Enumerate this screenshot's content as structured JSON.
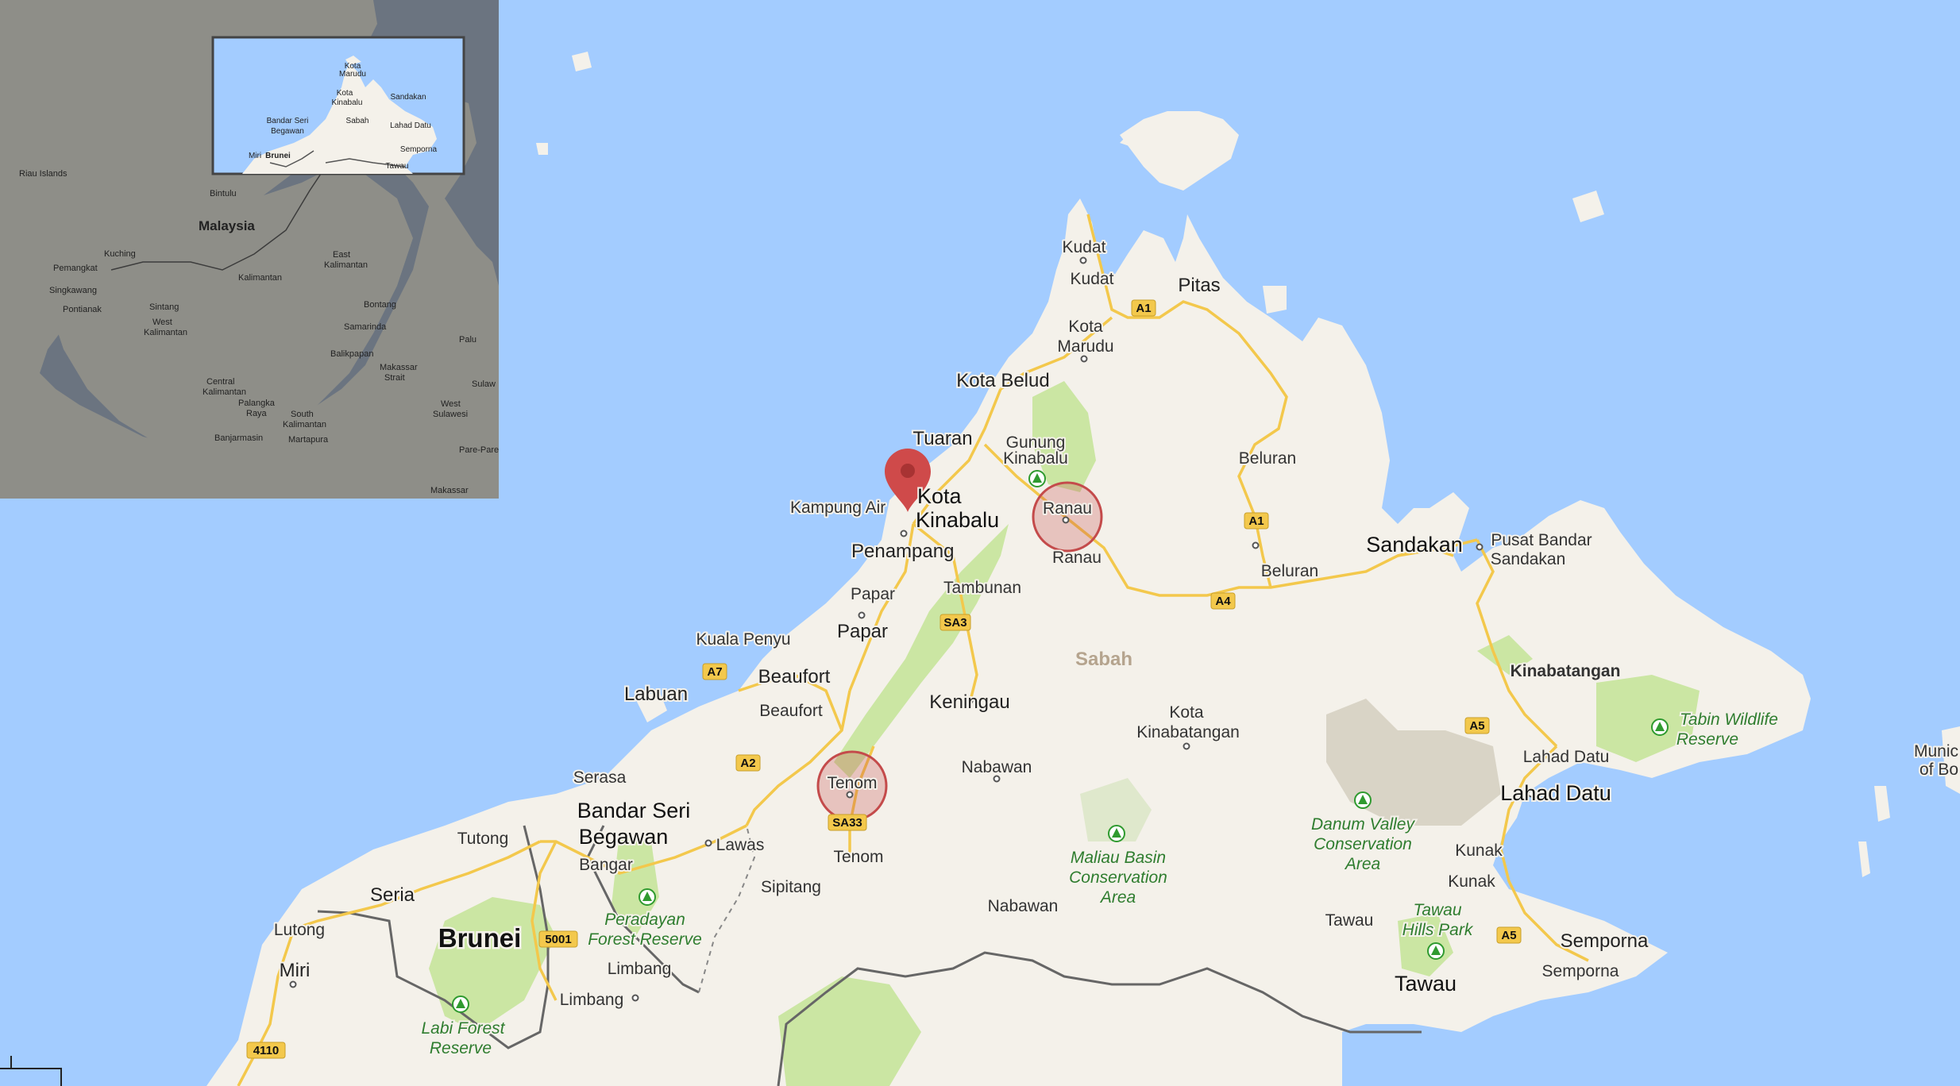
{
  "map": {
    "colors": {
      "water": "#a3ccff",
      "land": "#f4f1ea",
      "park": "#cbe6a3",
      "road": "#f3c84c",
      "border": "#666666",
      "pin": "#cf4a4a",
      "circle": "#c44b4b",
      "overview_land": "#8e8e88",
      "overview_water": "#6b7480"
    },
    "pin": {
      "icon": "map-pin-icon"
    },
    "circles": [
      {
        "label": "Ranau"
      },
      {
        "label": "Tenom"
      }
    ],
    "labels": {
      "kudat1": "Kudat",
      "kudat2": "Kudat",
      "pitas": "Pitas",
      "kota_marudu": "Kota\nMarudu",
      "kota_belud": "Kota Belud",
      "tuaran": "Tuaran",
      "gunung_kinabalu": "Gunung\nKinabalu",
      "kota_kinabalu_a": "Kota",
      "kota_kinabalu_b": "Kinabalu",
      "kampung_air": "Kampung Air",
      "penampang": "Penampang",
      "papar1": "Papar",
      "papar2": "Papar",
      "tambunan": "Tambunan",
      "ranau_below": "Ranau",
      "beluran1": "Beluran",
      "beluran2": "Beluran",
      "sandakan": "Sandakan",
      "pusat_a": "Pusat Bandar",
      "pusat_b": "Sandakan",
      "kuala_penyu": "Kuala Penyu",
      "beaufort1": "Beaufort",
      "beaufort2": "Beaufort",
      "labuan": "Labuan",
      "keningau": "Keningau",
      "sabah": "Sabah",
      "kota_kinabatangan_a": "Kota",
      "kota_kinabatangan_b": "Kinabatangan",
      "kinabatangan": "Kinabatangan",
      "nabawan1": "Nabawan",
      "nabawan2": "Nabawan",
      "lahad_datu1": "Lahad Datu",
      "lahad_datu2": "Lahad Datu",
      "tabin_a": "Tabin Wildlife",
      "tabin_b": "Reserve",
      "danum_a": "Danum Valley",
      "danum_b": "Conservation",
      "danum_c": "Area",
      "maliau_a": "Maliau Basin",
      "maliau_b": "Conservation",
      "maliau_c": "Area",
      "kunak1": "Kunak",
      "kunak2": "Kunak",
      "tawau1": "Tawau",
      "tawau2": "Tawau",
      "tawau_hills_a": "Tawau",
      "tawau_hills_b": "Hills Park",
      "semporna1": "Semporna",
      "semporna2": "Semporna",
      "serasa": "Serasa",
      "bsb_a": "Bandar Seri",
      "bsb_b": "Begawan",
      "tutong": "Tutong",
      "bangar": "Bangar",
      "lawas": "Lawas",
      "sipitang": "Sipitang",
      "tenom": "Tenom",
      "seria": "Seria",
      "lutong": "Lutong",
      "miri": "Miri",
      "brunei": "Brunei",
      "limbang1": "Limbang",
      "limbang2": "Limbang",
      "peradayan_a": "Peradayan",
      "peradayan_b": "Forest Reserve",
      "labi_a": "Labi Forest",
      "labi_b": "Reserve",
      "munic_a": "Munic",
      "munic_b": "of Bo"
    },
    "shields": [
      "A1",
      "A1",
      "A4",
      "A5",
      "A5",
      "A7",
      "A2",
      "SA3",
      "SA33",
      "5001",
      "4110"
    ]
  },
  "overview": {
    "malaysia": "Malaysia",
    "kuching": "Kuching",
    "pemangkat": "Pemangkat",
    "singkawang": "Singkawang",
    "pontianak": "Pontianak",
    "sintang": "Sintang",
    "west_a": "West",
    "west_b": "Kalimantan",
    "kalimantan": "Kalimantan",
    "east_a": "East",
    "east_b": "Kalimantan",
    "bontang": "Bontang",
    "samarinda": "Samarinda",
    "balikpapan": "Balikpapan",
    "central_a": "Central",
    "central_b": "Kalimantan",
    "palangka_a": "Palangka",
    "palangka_b": "Raya",
    "south_a": "South",
    "south_b": "Kalimantan",
    "banjarmasin": "Banjarmasin",
    "martapura": "Martapura",
    "bintulu": "Bintulu",
    "riau": "Riau Islands",
    "palu": "Palu",
    "sulaw": "Sulaw",
    "makassar_strait_a": "Makassar",
    "makassar_strait_b": "Strait",
    "west_sulawesi_a": "West",
    "west_sulawesi_b": "Sulawesi",
    "parepare": "Pare-Pare",
    "makassar": "Makassar",
    "inset": {
      "kota_marudu": "Kota\nMarudu",
      "kota_kinabalu": "Kota\nKinabalu",
      "sandakan": "Sandakan",
      "sabah": "Sabah",
      "lahad_datu": "Lahad Datu",
      "semporna": "Semporna",
      "tawau": "Tawau",
      "bsb_a": "Bandar Seri",
      "bsb_b": "Begawan",
      "miri": "Miri",
      "brunei": "Brunei"
    }
  }
}
